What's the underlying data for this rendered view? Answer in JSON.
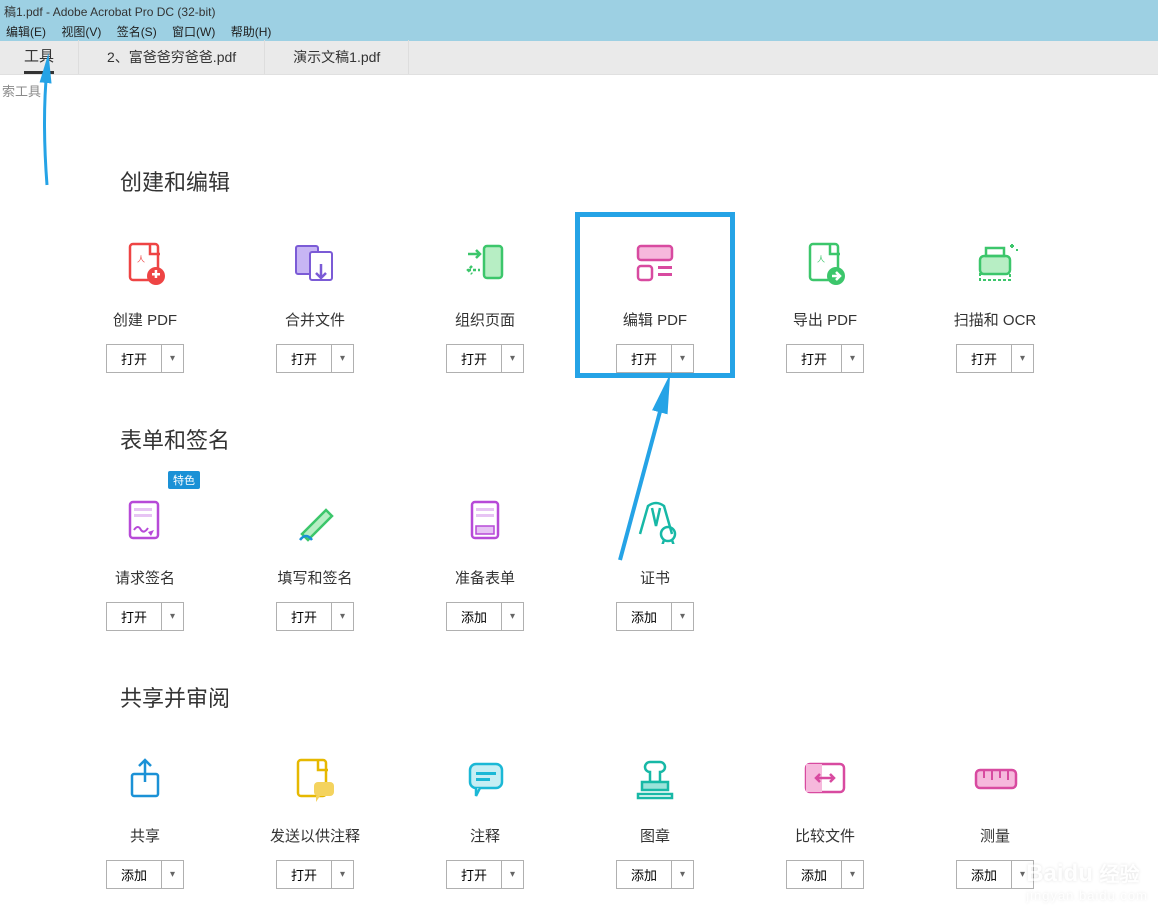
{
  "window": {
    "title": "稿1.pdf - Adobe Acrobat Pro DC (32-bit)"
  },
  "menu": [
    "编辑(E)",
    "视图(V)",
    "签名(S)",
    "窗口(W)",
    "帮助(H)"
  ],
  "tabs": [
    {
      "label": "工具",
      "active": true
    },
    {
      "label": "2、富爸爸穷爸爸.pdf",
      "active": false
    },
    {
      "label": "演示文稿1.pdf",
      "active": false
    }
  ],
  "search_label": "索工具",
  "sections": [
    {
      "title": "创建和编辑",
      "tools": [
        {
          "name": "创建 PDF",
          "button": "打开",
          "icon": "create-pdf"
        },
        {
          "name": "合并文件",
          "button": "打开",
          "icon": "combine"
        },
        {
          "name": "组织页面",
          "button": "打开",
          "icon": "organize"
        },
        {
          "name": "编辑 PDF",
          "button": "打开",
          "icon": "edit-pdf",
          "highlight": true
        },
        {
          "name": "导出 PDF",
          "button": "打开",
          "icon": "export-pdf"
        },
        {
          "name": "扫描和 OCR",
          "button": "打开",
          "icon": "scan-ocr"
        }
      ]
    },
    {
      "title": "表单和签名",
      "tools": [
        {
          "name": "请求签名",
          "button": "打开",
          "icon": "request-sign",
          "badge": "特色"
        },
        {
          "name": "填写和签名",
          "button": "打开",
          "icon": "fill-sign"
        },
        {
          "name": "准备表单",
          "button": "添加",
          "icon": "prepare-form"
        },
        {
          "name": "证书",
          "button": "添加",
          "icon": "certificate"
        }
      ]
    },
    {
      "title": "共享并审阅",
      "tools": [
        {
          "name": "共享",
          "button": "添加",
          "icon": "share"
        },
        {
          "name": "发送以供注释",
          "button": "打开",
          "icon": "send-comment"
        },
        {
          "name": "注释",
          "button": "打开",
          "icon": "comment"
        },
        {
          "name": "图章",
          "button": "添加",
          "icon": "stamp"
        },
        {
          "name": "比较文件",
          "button": "添加",
          "icon": "compare"
        },
        {
          "name": "测量",
          "button": "添加",
          "icon": "measure"
        }
      ]
    }
  ],
  "watermark": {
    "brand": "Baidu",
    "sub": "jingyan.baidu.com",
    "side": "经验"
  }
}
